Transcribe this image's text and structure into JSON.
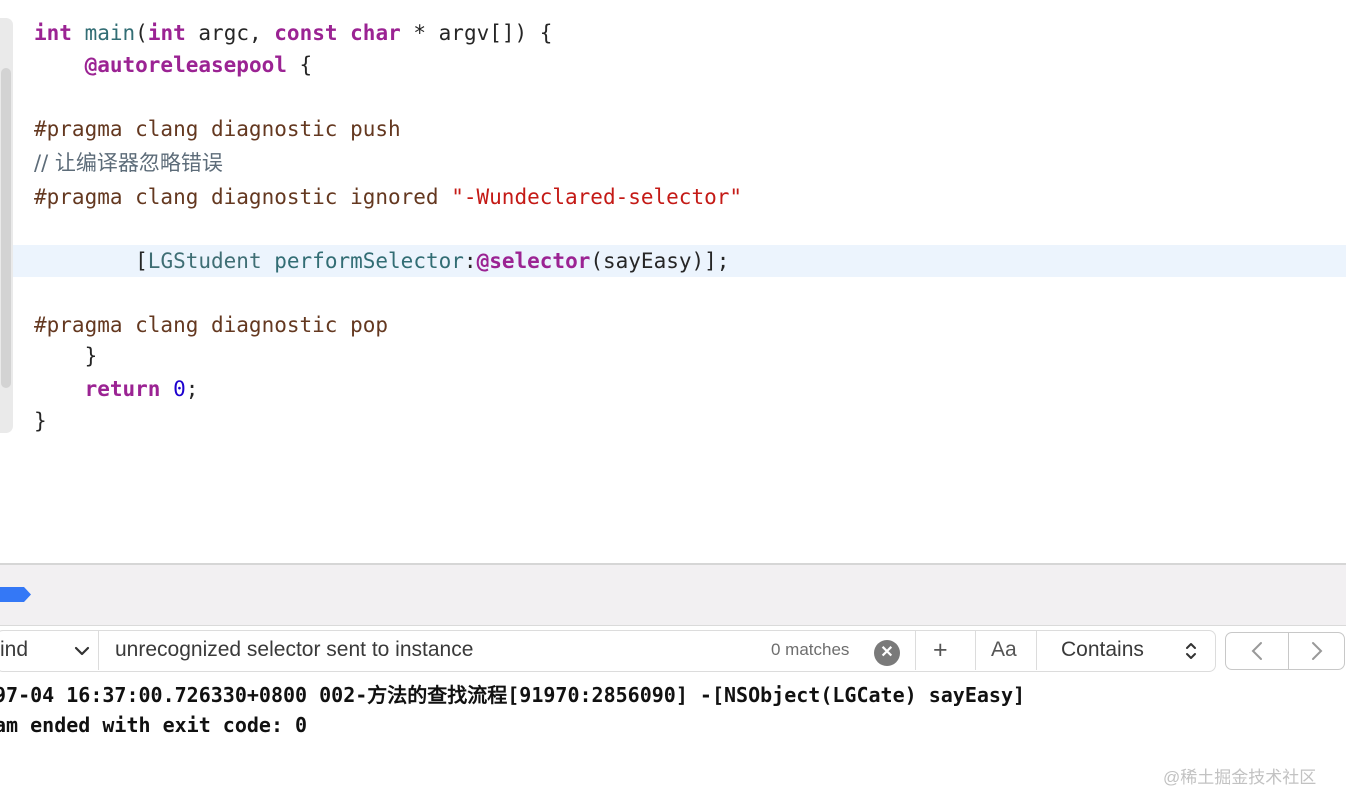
{
  "code": {
    "l1": {
      "kw_int": "int",
      "fn_main": "main",
      "p1": "(",
      "kw_int2": "int",
      "argc": " argc, ",
      "kw_const": "const",
      "sp": " ",
      "kw_char": "char",
      "rest": " * argv[]) {"
    },
    "l2": {
      "indent": "    ",
      "kw": "@autoreleasepool",
      "rest": " {"
    },
    "l4": "#pragma clang diagnostic push",
    "l5": "// 让编译器忽略错误",
    "l6": {
      "pp": "#pragma clang diagnostic ignored ",
      "str": "\"-Wundeclared-selector\""
    },
    "l8": {
      "indent": "        [",
      "cls": "LGStudent",
      "sp": " ",
      "method": "performSelector",
      "colon": ":",
      "kw": "@selector",
      "rest": "(sayEasy)];"
    },
    "l10": "#pragma clang diagnostic pop",
    "l11": "    }",
    "l12": {
      "indent": "    ",
      "kw": "return",
      "sp": " ",
      "num": "0",
      "semi": ";"
    },
    "l13": "}"
  },
  "find_bar": {
    "mode": "ind",
    "query": "unrecognized selector sent to instance",
    "matches": "0 matches",
    "add_label": "+",
    "case_label": "Aa",
    "match_type": "Contains",
    "prev_label": "‹",
    "next_label": "›"
  },
  "console": {
    "line1": "97-04 16:37:00.726330+0800 002-方法的查找流程[91970:2856090] -[NSObject(LGCate) sayEasy]",
    "line2": "am ended with exit code: 0"
  },
  "watermark": "@稀土掘金技术社区",
  "colors": {
    "keyword": "#9b2393",
    "preprocessor": "#643820",
    "string": "#c41a16",
    "comment": "#5d6c79",
    "number": "#1c00cf",
    "breakpoint": "#3478f6"
  }
}
